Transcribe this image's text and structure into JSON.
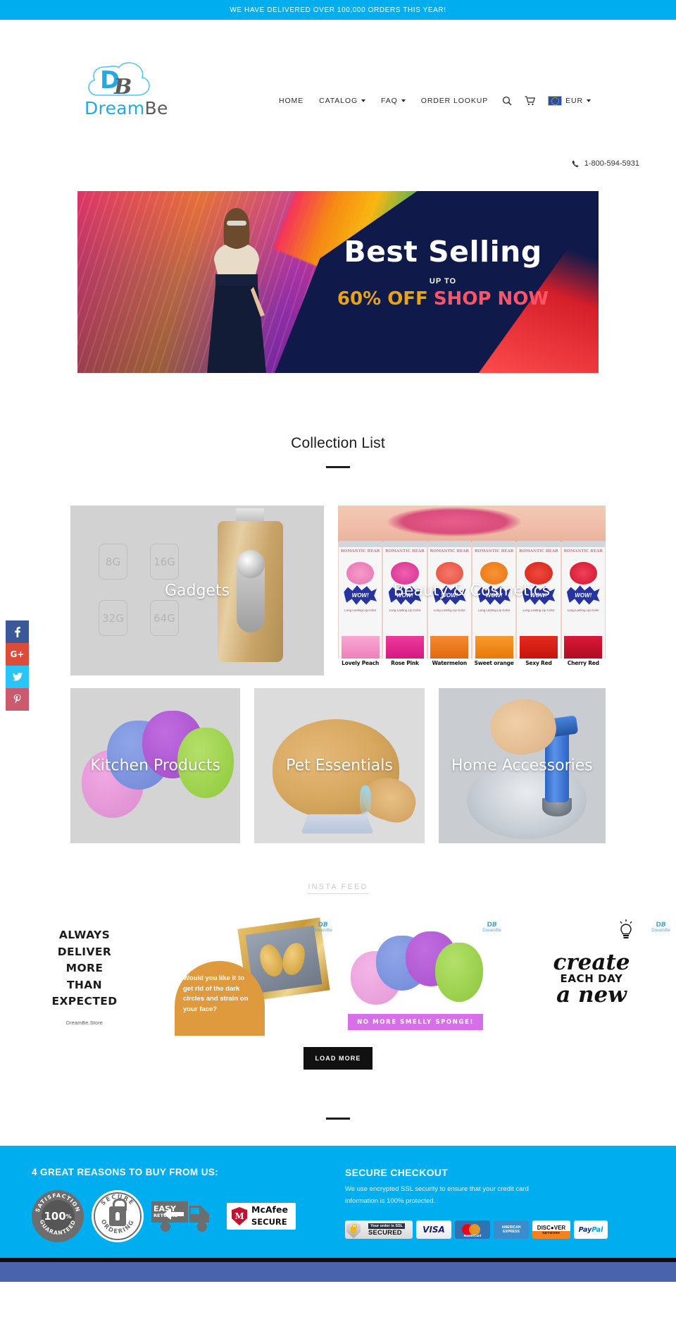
{
  "announcement": {
    "text": "WE HAVE DELIVERED OVER 100,000 ORDERS THIS YEAR!",
    "bg": "#00aeef"
  },
  "brand": {
    "name": "DreamBe",
    "part1": "Dream",
    "part2": "Be",
    "monogram_d": "D",
    "monogram_b": "B",
    "accent": "#29a8e0",
    "dark": "#5b5b5b"
  },
  "nav": {
    "items": [
      {
        "label": "HOME",
        "has_dropdown": false
      },
      {
        "label": "CATALOG",
        "has_dropdown": true
      },
      {
        "label": "FAQ",
        "has_dropdown": true
      },
      {
        "label": "ORDER LOOKUP",
        "has_dropdown": false
      }
    ],
    "search_icon": "search-icon",
    "cart_icon": "cart-icon",
    "currency": {
      "code": "EUR",
      "flag": "european-union-flag"
    }
  },
  "contact": {
    "phone": "1-800-594-5931",
    "phone_icon": "phone-icon"
  },
  "social_share": [
    {
      "name": "facebook",
      "glyph": "f",
      "color": "#3b5998"
    },
    {
      "name": "google-plus",
      "glyph": "G+",
      "color": "#dd4b39"
    },
    {
      "name": "twitter",
      "glyph": "t",
      "color": "#29c5f6"
    },
    {
      "name": "pinterest",
      "glyph": "P",
      "color": "#cb5a6e"
    }
  ],
  "hero": {
    "title": "Best Selling",
    "upto": "UP TO",
    "discount": "60% OFF",
    "cta": "SHOP NOW",
    "discount_color": "#e8a416",
    "cta_color": "#ff5566",
    "panel_color": "#101a4a"
  },
  "collections": {
    "heading": "Collection List",
    "items": [
      {
        "label": "Gadgets",
        "sizes": [
          "8G",
          "16G",
          "32G",
          "64G"
        ]
      },
      {
        "label": "Beauty & Cosmetics",
        "product_brand": "ROMANTIC BEAR",
        "product_tagline": "Long Lasting Lip Color",
        "burst": "WOW!",
        "shade_names": [
          "Lovely Peach",
          "Rose Pink",
          "Watermelon",
          "Sweet orange",
          "Sexy Red",
          "Cherry Red"
        ]
      },
      {
        "label": "Kitchen Products"
      },
      {
        "label": "Pet Essentials"
      },
      {
        "label": "Home Accessories"
      }
    ]
  },
  "insta": {
    "label": "INSTA FEED",
    "load_more": "LOAD MORE",
    "posts": [
      {
        "name": "always-deliver-post",
        "lines": [
          "ALWAYS",
          "DELIVER",
          "MORE",
          "THAN",
          "EXPECTED"
        ],
        "handle": "DreamBe.Store"
      },
      {
        "name": "eye-mask-post",
        "caption": "Would you like it to get rid of the dark circles and strain on your face?",
        "watermark": "DreamBe"
      },
      {
        "name": "silicone-sponge-post",
        "banner": "NO MORE SMELLY SPONGE!",
        "watermark": "DreamBe"
      },
      {
        "name": "create-each-day-post",
        "line1": "create",
        "line2": "EACH DAY",
        "line3": "a new",
        "watermark": "DreamBe"
      }
    ]
  },
  "footer": {
    "reasons_heading": "4 GREAT REASONS TO BUY FROM US:",
    "badges": [
      {
        "name": "satisfaction-guaranteed-badge",
        "arc_top": "SATISFACTION",
        "arc_bottom": "GUARANTEED",
        "center": "100",
        "center_sup": "%"
      },
      {
        "name": "secure-ordering-badge",
        "arc_top": "SECURE",
        "arc_bottom": "ORDERING"
      },
      {
        "name": "easy-returns-badge",
        "line1": "EASY",
        "line2": "RETURNS"
      },
      {
        "name": "mcafee-secure-badge",
        "line1": "McAfee",
        "line2": "SECURE",
        "mark": "M"
      }
    ],
    "secure_checkout": {
      "heading": "SECURE CHECKOUT",
      "text": "We use encrypted SSL security to ensure that your credit card information is 100% protected."
    },
    "payments": [
      {
        "name": "ssl-secured-badge",
        "line1": "Your order is SSL",
        "line2": "SECURED"
      },
      {
        "name": "visa-badge",
        "label": "VISA"
      },
      {
        "name": "mastercard-badge",
        "label": "MasterCard"
      },
      {
        "name": "amex-badge",
        "line1": "AMERICAN",
        "line2": "EXPRESS"
      },
      {
        "name": "discover-badge",
        "line1": "DISC●VER",
        "line2": "NETWORK"
      },
      {
        "name": "paypal-badge",
        "p1": "Pay",
        "p2": "Pal"
      }
    ],
    "bg": "#00aeef",
    "bar_black": "#0d0d0d",
    "bar_blue": "#4a63ab"
  }
}
